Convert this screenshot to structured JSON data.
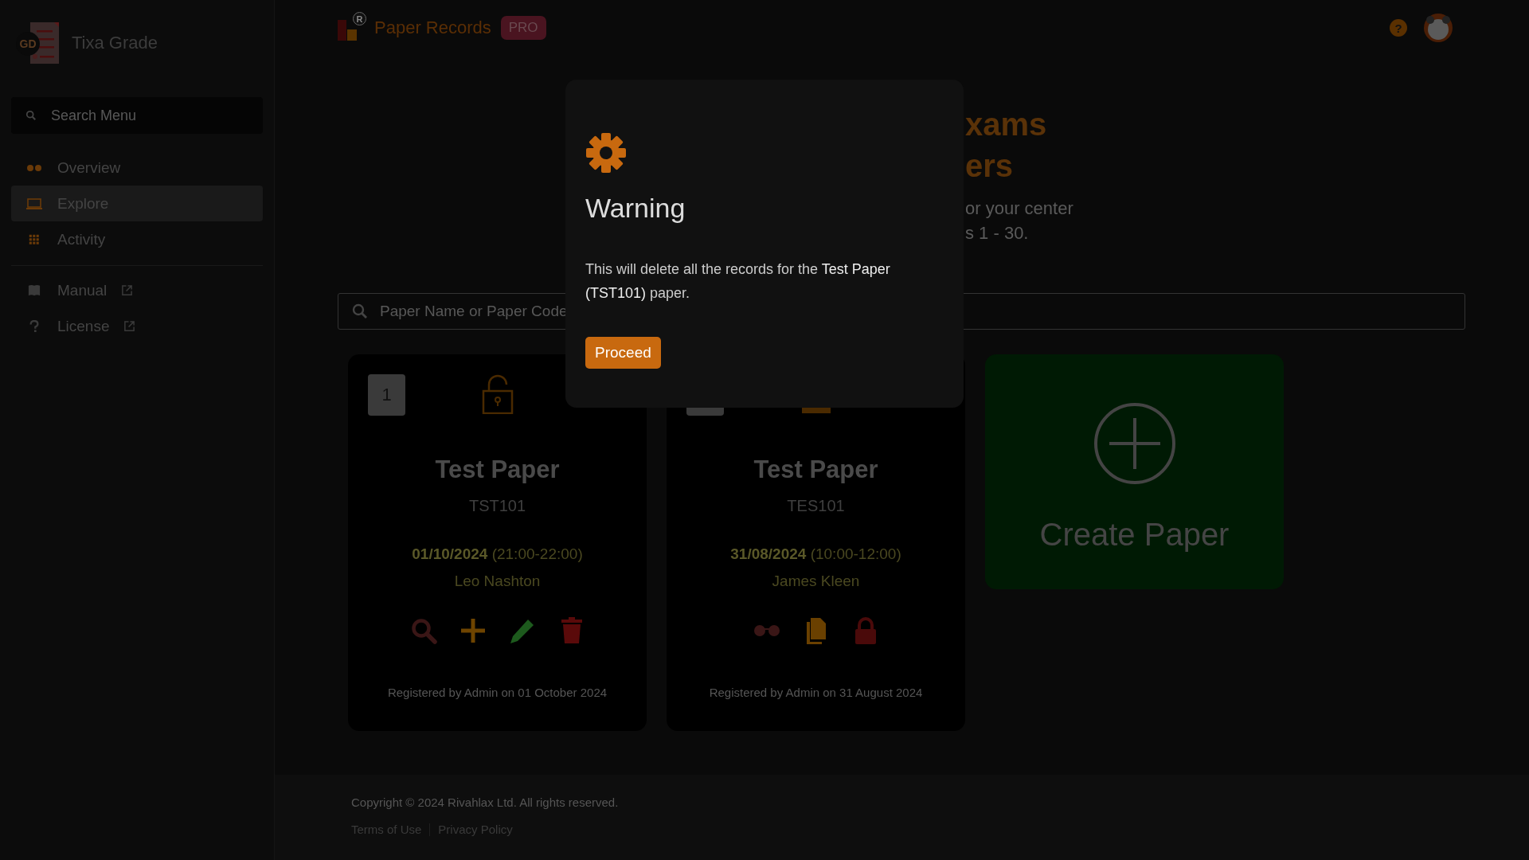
{
  "app": {
    "name": "Tixa Grade",
    "logo_badge": "GD"
  },
  "sidebar": {
    "search": {
      "placeholder": "Search Menu"
    },
    "items": [
      {
        "label": "Overview",
        "kind": "dots",
        "selected": false
      },
      {
        "label": "Explore",
        "kind": "monitor",
        "selected": true
      },
      {
        "label": "Activity",
        "kind": "grid",
        "selected": false
      }
    ],
    "links": [
      {
        "label": "Manual",
        "kind": "book"
      },
      {
        "label": "License",
        "kind": "question"
      }
    ]
  },
  "header": {
    "logo_mark": "R",
    "title": "Paper Records",
    "badge": "PRO",
    "help": "?"
  },
  "hero": {
    "lines": [
      "xams",
      "ers"
    ],
    "sub_lines": [
      "or your center",
      "s 1 - 30."
    ]
  },
  "search": {
    "placeholder": "Paper Name or Paper Code"
  },
  "papers": [
    {
      "number": "1",
      "locked": false,
      "title": "Test Paper",
      "code": "TST101",
      "date": "01/10/2024",
      "time": "(21:00-22:00)",
      "person": "Leo Nashton",
      "actions": [
        {
          "kind": "search"
        },
        {
          "kind": "add"
        },
        {
          "kind": "edit"
        },
        {
          "kind": "delete"
        }
      ],
      "registered": "Registered by Admin on 01 October 2024"
    },
    {
      "locked": true,
      "title": "Test Paper",
      "code": "TES101",
      "date": "31/08/2024",
      "time": "(10:00-12:00)",
      "person": "James Kleen",
      "actions": [
        {
          "kind": "view"
        },
        {
          "kind": "copy"
        },
        {
          "kind": "lock"
        }
      ],
      "registered": "Registered by Admin on 31 August 2024"
    }
  ],
  "create": {
    "label": "Create Paper"
  },
  "footer": {
    "copyright": "Copyright © 2024 Rivahlax Ltd. All rights reserved.",
    "links": [
      "Terms of Use",
      "Privacy Policy"
    ]
  },
  "dialog": {
    "title": "Warning",
    "message": "This will delete all the records for the **Test Paper (TST101)** paper.",
    "button": "Proceed"
  }
}
